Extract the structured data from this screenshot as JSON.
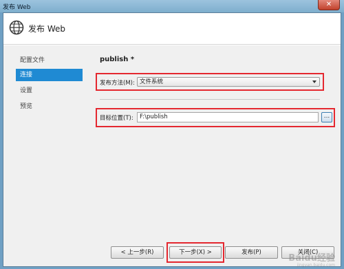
{
  "window": {
    "title": "发布 Web",
    "close_glyph": "✕"
  },
  "header": {
    "title": "发布 Web",
    "icon": "globe-icon"
  },
  "sidebar": {
    "items": [
      {
        "label": "配置文件",
        "active": false
      },
      {
        "label": "连接",
        "active": true
      },
      {
        "label": "设置",
        "active": false
      },
      {
        "label": "预览",
        "active": false
      }
    ]
  },
  "content": {
    "profile_title": "publish *",
    "publish_method": {
      "label": "发布方法(M):",
      "value": "文件系统"
    },
    "target_location": {
      "label": "目标位置(T):",
      "value": "F:\\publish",
      "browse_label": "..."
    }
  },
  "footer": {
    "prev": "< 上一步(R)",
    "next": "下一步(X) >",
    "publish": "发布(P)",
    "close": "关闭(C)"
  },
  "watermark": {
    "text": "Baidu经验",
    "sub": "jingyan.baidu.com"
  },
  "colors": {
    "accent": "#1f8ad3",
    "highlight": "#e4272f"
  }
}
